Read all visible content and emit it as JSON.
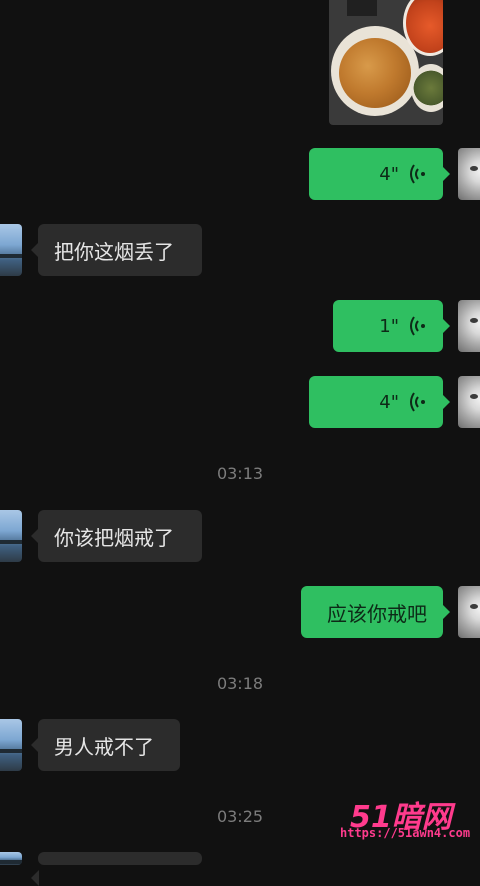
{
  "messages": {
    "m1": {
      "type": "voice",
      "duration": "4\""
    },
    "m2": {
      "type": "text",
      "text": "把你这烟丢了"
    },
    "m3": {
      "type": "voice",
      "duration": "1\""
    },
    "m4": {
      "type": "voice",
      "duration": "4\""
    },
    "t1": "03:13",
    "m5": {
      "type": "text",
      "text": "你该把烟戒了"
    },
    "m6": {
      "type": "text",
      "text": "应该你戒吧"
    },
    "t2": "03:18",
    "m7": {
      "type": "text",
      "text": "男人戒不了"
    },
    "t3": "03:25"
  },
  "watermark": {
    "logo": "51暗网",
    "url": "https://51awn4.com"
  },
  "colors": {
    "outgoing": "#2fbf61",
    "incoming": "#2c2c2c",
    "background": "#111111"
  }
}
